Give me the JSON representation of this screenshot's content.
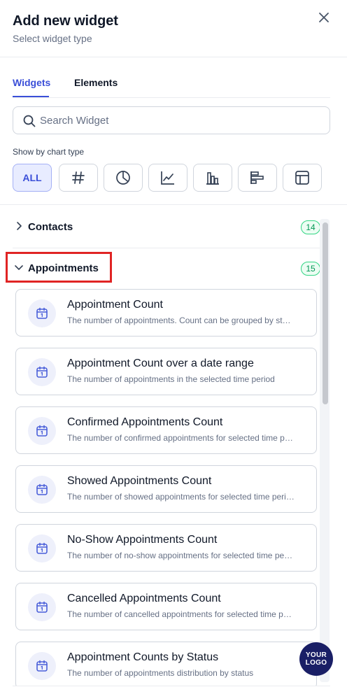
{
  "header": {
    "title": "Add new widget",
    "subtitle": "Select widget type"
  },
  "tabs": [
    {
      "label": "Widgets",
      "active": true
    },
    {
      "label": "Elements",
      "active": false
    }
  ],
  "search": {
    "placeholder": "Search Widget",
    "value": ""
  },
  "filter": {
    "label": "Show by chart type",
    "types": [
      {
        "label": "ALL",
        "icon": "all-text",
        "active": true
      },
      {
        "icon": "hash-icon",
        "active": false
      },
      {
        "icon": "pie-chart-icon",
        "active": false
      },
      {
        "icon": "line-chart-icon",
        "active": false
      },
      {
        "icon": "bar-chart-icon",
        "active": false
      },
      {
        "icon": "horizontal-bar-chart-icon",
        "active": false
      },
      {
        "icon": "table-icon",
        "active": false
      }
    ]
  },
  "groups": [
    {
      "label": "Contacts",
      "count": "14",
      "expanded": false
    },
    {
      "label": "Appointments",
      "count": "15",
      "expanded": true
    }
  ],
  "widgets": [
    {
      "title": "Appointment Count",
      "description": "The number of appointments. Count can be grouped by status"
    },
    {
      "title": "Appointment Count over a date range",
      "description": "The number of appointments in the selected time period"
    },
    {
      "title": "Confirmed Appointments Count",
      "description": "The number of confirmed appointments for selected time period"
    },
    {
      "title": "Showed Appointments Count",
      "description": "The number of showed appointments for selected time period"
    },
    {
      "title": "No-Show Appointments Count",
      "description": "The number of no-show appointments for selected time period"
    },
    {
      "title": "Cancelled Appointments Count",
      "description": "The number of cancelled appointments for selected time period"
    },
    {
      "title": "Appointment Counts by Status",
      "description": "The number of appointments distribution by status"
    }
  ],
  "logo": {
    "line1": "YOUR",
    "line2": "LOGO"
  },
  "colors": {
    "accent": "#3b4fd8",
    "highlight": "#e02424",
    "badge": "#039855"
  }
}
